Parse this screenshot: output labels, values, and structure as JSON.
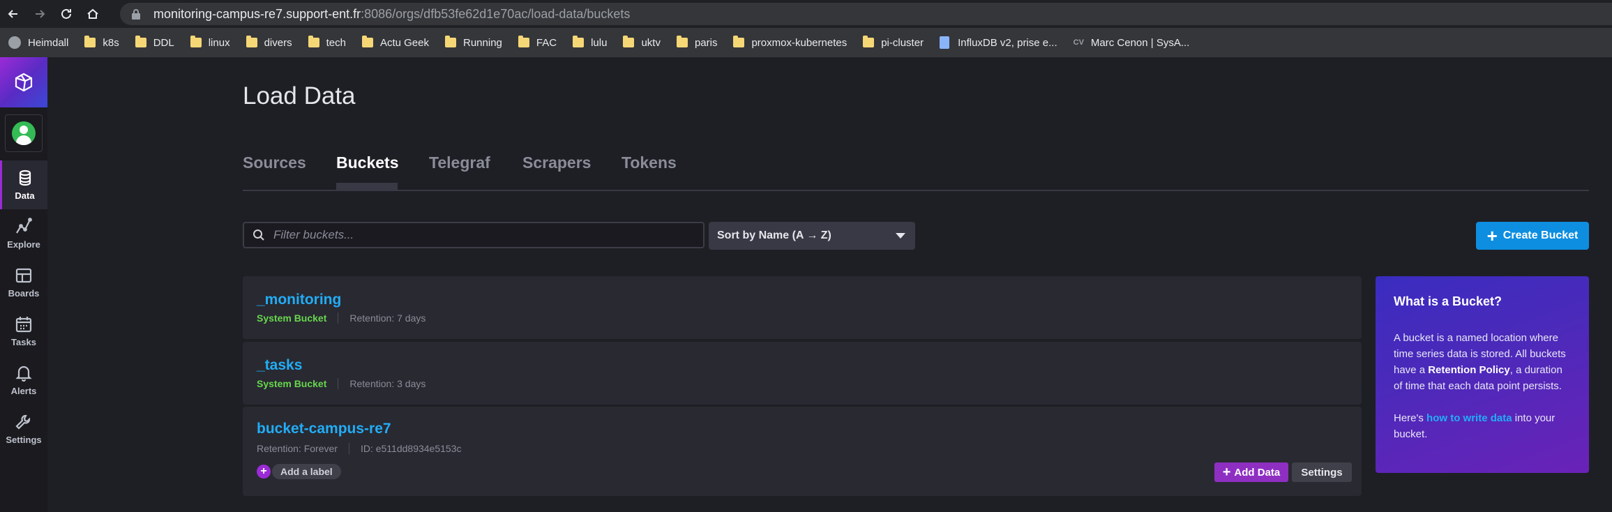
{
  "browser": {
    "url_host": "monitoring-campus-re7.support-ent.fr",
    "url_rest": ":8086/orgs/dfb53fe62d1e70ac/load-data/buckets",
    "bookmarks": [
      {
        "label": "Heimdall",
        "icon": "round"
      },
      {
        "label": "k8s",
        "icon": "folder"
      },
      {
        "label": "DDL",
        "icon": "folder"
      },
      {
        "label": "linux",
        "icon": "folder"
      },
      {
        "label": "divers",
        "icon": "folder"
      },
      {
        "label": "tech",
        "icon": "folder"
      },
      {
        "label": "Actu Geek",
        "icon": "folder"
      },
      {
        "label": "Running",
        "icon": "folder"
      },
      {
        "label": "FAC",
        "icon": "folder"
      },
      {
        "label": "lulu",
        "icon": "folder"
      },
      {
        "label": "uktv",
        "icon": "folder"
      },
      {
        "label": "paris",
        "icon": "folder"
      },
      {
        "label": "proxmox-kubernetes",
        "icon": "folder"
      },
      {
        "label": "pi-cluster",
        "icon": "folder"
      },
      {
        "label": "InfluxDB v2, prise e...",
        "icon": "doc"
      },
      {
        "label": "Marc Cenon | SysA...",
        "icon": "cv"
      }
    ]
  },
  "sidebar": {
    "items": [
      {
        "label": "Data",
        "icon": "database-icon",
        "active": true
      },
      {
        "label": "Explore",
        "icon": "graph-line-icon"
      },
      {
        "label": "Boards",
        "icon": "dashboard-grid-icon"
      },
      {
        "label": "Tasks",
        "icon": "calendar-icon"
      },
      {
        "label": "Alerts",
        "icon": "bell-icon"
      },
      {
        "label": "Settings",
        "icon": "wrench-icon"
      }
    ]
  },
  "page": {
    "title": "Load Data",
    "tabs": [
      {
        "label": "Sources"
      },
      {
        "label": "Buckets",
        "active": true
      },
      {
        "label": "Telegraf"
      },
      {
        "label": "Scrapers"
      },
      {
        "label": "Tokens"
      }
    ]
  },
  "controls": {
    "filter_placeholder": "Filter buckets...",
    "sort_label": "Sort by Name (A → Z)",
    "create_label": "Create Bucket"
  },
  "buckets": [
    {
      "name": "_monitoring",
      "type": "System Bucket",
      "retention": "Retention: 7 days"
    },
    {
      "name": "_tasks",
      "type": "System Bucket",
      "retention": "Retention: 3 days"
    },
    {
      "name": "bucket-campus-re7",
      "retention": "Retention: Forever",
      "id": "ID: e511dd8934e5153c",
      "label_action": "Add a label",
      "add_data": "Add Data",
      "settings": "Settings"
    }
  ],
  "info_panel": {
    "title": "What is a Bucket?",
    "p1_a": "A bucket is a named location where time series data is stored. All buckets have a ",
    "p1_b": "Retention Policy",
    "p1_c": ", a duration of time that each data point persists.",
    "p2_a": "Here's ",
    "p2_link": "how to write data",
    "p2_b": " into your bucket."
  },
  "colors": {
    "accent_blue": "#22adf6",
    "system_green": "#67d74e",
    "brand_purple": "#9b2bd6"
  }
}
